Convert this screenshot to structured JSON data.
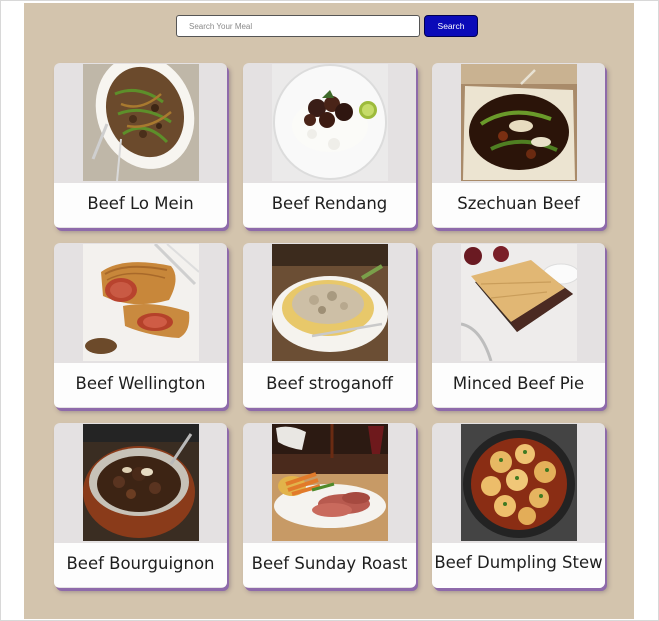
{
  "search": {
    "placeholder": "Search Your Meal",
    "value": "",
    "button_label": "Search"
  },
  "meals": [
    {
      "title": "Beef Lo Mein"
    },
    {
      "title": "Beef Rendang"
    },
    {
      "title": "Szechuan Beef"
    },
    {
      "title": "Beef Wellington"
    },
    {
      "title": "Beef stroganoff"
    },
    {
      "title": "Minced Beef Pie"
    },
    {
      "title": "Beef Bourguignon"
    },
    {
      "title": "Beef Sunday Roast"
    },
    {
      "title": "Beef Dumpling Stew"
    }
  ]
}
